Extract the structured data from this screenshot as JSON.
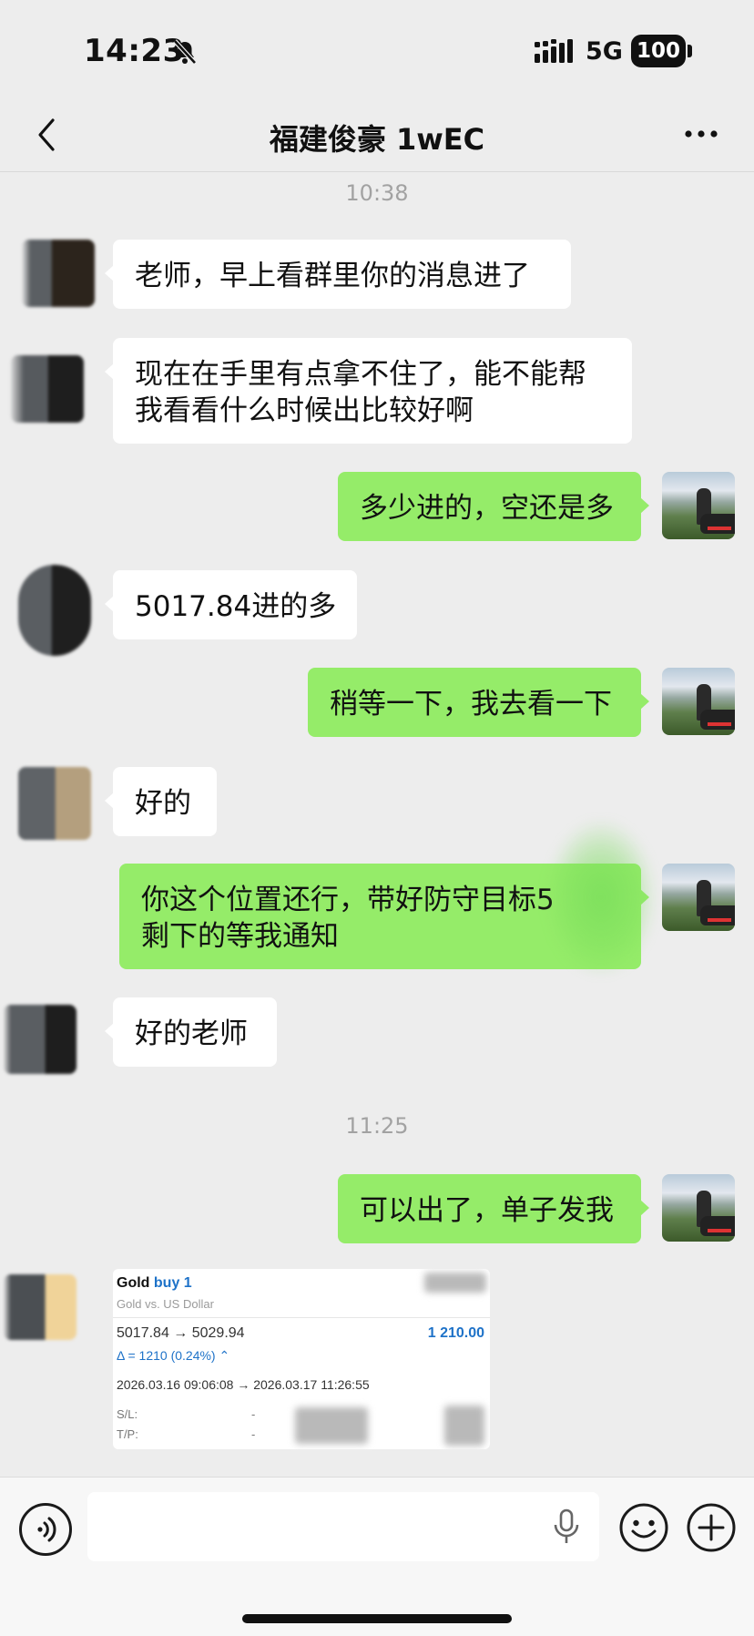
{
  "status_bar": {
    "time": "14:23",
    "network": "5G",
    "battery": "100"
  },
  "header": {
    "title": "福建俊豪 1wEC"
  },
  "timestamps": [
    "10:38",
    "11:25"
  ],
  "messages": [
    {
      "side": "in",
      "lines": [
        "老师，早上看群里你的消息进了"
      ]
    },
    {
      "side": "in",
      "lines": [
        "现在在手里有点拿不住了，能不能帮",
        "我看看什么时候出比较好啊"
      ]
    },
    {
      "side": "out",
      "lines": [
        "多少进的，空还是多"
      ]
    },
    {
      "side": "in",
      "lines": [
        "5017.84进的多"
      ]
    },
    {
      "side": "out",
      "lines": [
        "稍等一下，我去看一下"
      ]
    },
    {
      "side": "in",
      "lines": [
        "好的"
      ]
    },
    {
      "side": "out",
      "lines": [
        "你这个位置还行，带好防守目标5",
        "剩下的等我通知"
      ]
    },
    {
      "side": "in",
      "lines": [
        "好的老师"
      ]
    },
    {
      "side": "out",
      "lines": [
        "可以出了，单子发我"
      ]
    }
  ],
  "trade_card": {
    "symbol": "Gold",
    "side": "buy 1",
    "description": "Gold vs. US Dollar",
    "prices": "5017.84 → 5029.94",
    "profit": "1 210.00",
    "delta": "Δ = 1210 (0.24%) ⌃",
    "dates": "2026.03.16 09:06:08 → 2026.03.17 11:26:55",
    "sl_label": "S/L:",
    "sl_value": "-",
    "tp_label": "T/P:",
    "tp_value": "-"
  },
  "colors": {
    "background": "#ededed",
    "outgoing_bubble": "#95ec69",
    "incoming_bubble": "#ffffff",
    "accent_blue": "#1e72c8"
  },
  "icons": [
    "back-chevron-icon",
    "more-dots-icon",
    "bell-off-icon",
    "signal-icon",
    "voice-icon",
    "mic-icon",
    "emoji-icon",
    "plus-icon"
  ]
}
